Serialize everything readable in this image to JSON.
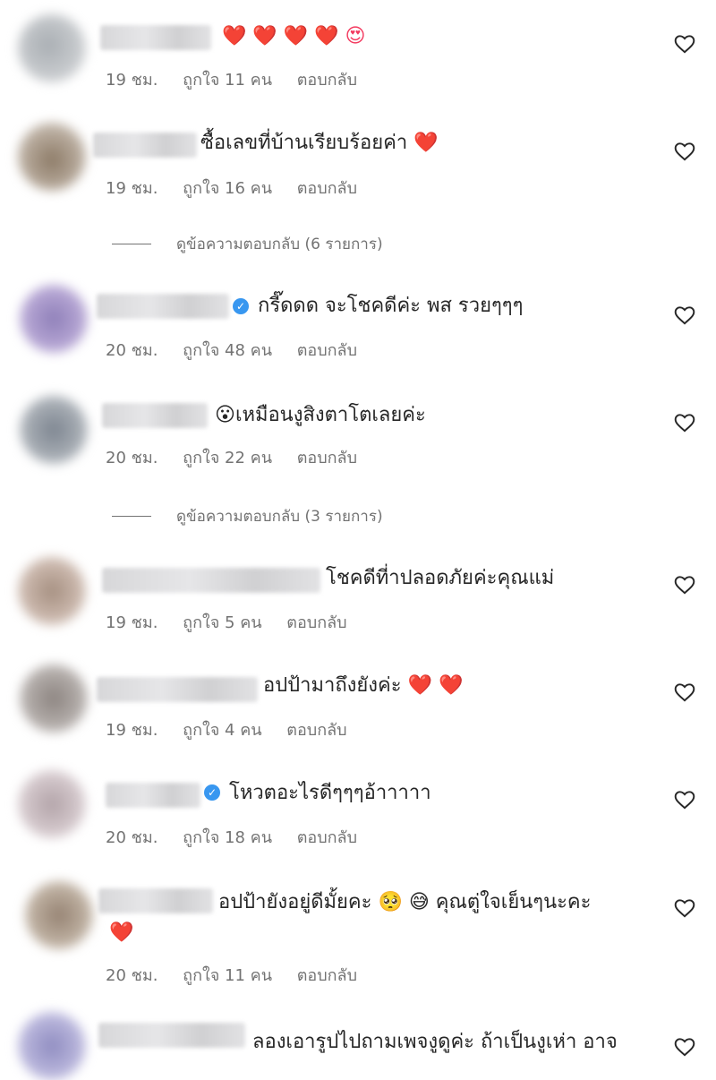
{
  "comments": [
    {
      "text": "",
      "emoji": "❤️ ❤️ ❤️ ❤️ 😍",
      "time": "19 ชม.",
      "likes": "ถูกใจ 11 คน",
      "reply": "ตอบกลับ"
    },
    {
      "text": "ซื้อเลขที่บ้านเรียบร้อยค่า",
      "emoji": "❤️",
      "time": "19 ชม.",
      "likes": "ถูกใจ 16 คน",
      "reply": "ตอบกลับ"
    },
    {
      "text": "กรี๊ดดด จะโชคดีค่ะ พส รวยๆๆๆ",
      "emoji": "",
      "time": "20 ชม.",
      "likes": "ถูกใจ 48 คน",
      "reply": "ตอบกลับ"
    },
    {
      "text": "เหมือนงูสิงตาโตเลยค่ะ",
      "emoji": "😮",
      "time": "20 ชม.",
      "likes": "ถูกใจ 22 คน",
      "reply": "ตอบกลับ"
    },
    {
      "text": "โชคดีที่าปลอดภัยค่ะคุณแม่",
      "emoji": "",
      "time": "19 ชม.",
      "likes": "ถูกใจ 5 คน",
      "reply": "ตอบกลับ"
    },
    {
      "text": "อปป้ามาถึงยังค่ะ",
      "emoji": "❤️ ❤️",
      "time": "19 ชม.",
      "likes": "ถูกใจ 4 คน",
      "reply": "ตอบกลับ"
    },
    {
      "text": "โหวตอะไรดีๆๆๆอ้าาาาา",
      "emoji": "",
      "time": "20 ชม.",
      "likes": "ถูกใจ 18 คน",
      "reply": "ตอบกลับ"
    },
    {
      "text": "อปป้ายังอยู่ดีมั้ยคะ 🥺 😅  คุณตู่ใจเย็นๆนะคะ",
      "emoji": "❤️",
      "time": "20 ชม.",
      "likes": "ถูกใจ 11 คน",
      "reply": "ตอบกลับ"
    },
    {
      "text": "ลองเอารูปไปถามเพจงูดูค่ะ ถ้าเป็นงูเห่า อาจ",
      "emoji": "",
      "time": "",
      "likes": "",
      "reply": ""
    }
  ],
  "view_replies": [
    "ดูข้อความตอบกลับ (6 รายการ)",
    "ดูข้อความตอบกลับ (3 รายการ)"
  ],
  "icons": {
    "like": "heart-outline-icon",
    "verified": "verified-badge-icon"
  },
  "colors": {
    "meta": "#737373",
    "verified": "#3897f0",
    "heart": "#f33a5f"
  }
}
